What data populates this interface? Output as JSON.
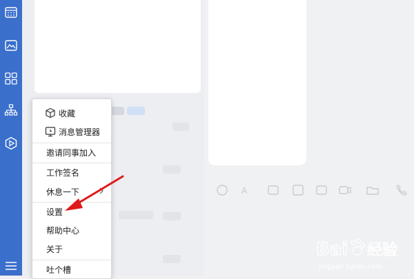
{
  "menu": {
    "items": [
      {
        "label": "收藏",
        "icon": "cube-icon"
      },
      {
        "label": "消息管理器",
        "icon": "message-manager-icon"
      },
      {
        "label": "邀请同事加入"
      },
      {
        "label": "工作签名"
      },
      {
        "label": "休息一下",
        "submenu": true
      },
      {
        "label": "设置"
      },
      {
        "label": "帮助中心"
      },
      {
        "label": "关于"
      },
      {
        "label": "吐个槽"
      }
    ]
  },
  "watermark": {
    "brand": "Bai",
    "brand_suffix": "经验",
    "url": "jingyan.baidu.com"
  },
  "colors": {
    "sidebar": "#3a6fcb",
    "arrow": "#e0191b"
  }
}
